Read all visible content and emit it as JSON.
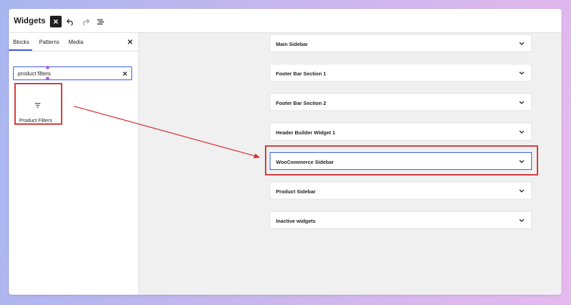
{
  "topbar": {
    "title": "Widgets"
  },
  "toolbar_icons": [
    "close-icon",
    "undo-icon",
    "redo-icon",
    "list-view-icon"
  ],
  "sidebar": {
    "tabs": [
      {
        "label": "Blocks",
        "active": true
      },
      {
        "label": "Patterns",
        "active": false
      },
      {
        "label": "Media",
        "active": false
      }
    ],
    "search": {
      "value": "product filters",
      "placeholder": "Search"
    },
    "block_results": [
      {
        "label": "Product Filters",
        "icon": "filter-icon"
      }
    ]
  },
  "widget_areas": [
    {
      "label": "Main Sidebar"
    },
    {
      "label": "Footer Bar Section 1"
    },
    {
      "label": "Footer Bar Section 2"
    },
    {
      "label": "Header Builder Widget 1"
    },
    {
      "label": "WooCommerce Sidebar",
      "highlighted": true
    },
    {
      "label": "Product Sidebar"
    },
    {
      "label": "Inactive widgets"
    }
  ],
  "colors": {
    "accent": "#3858e9",
    "annotation_red": "#d63638",
    "selection_purple": "#b05de6"
  }
}
